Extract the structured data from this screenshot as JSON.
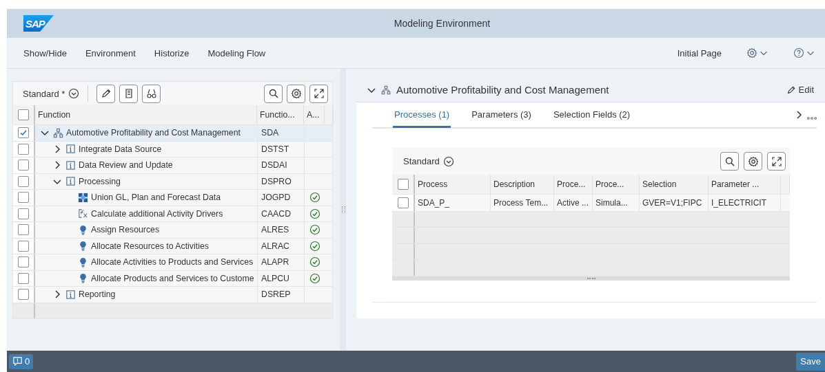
{
  "header": {
    "logo": "SAP",
    "title": "Modeling Environment"
  },
  "menu": {
    "items": [
      "Show/Hide",
      "Environment",
      "Historize",
      "Modeling Flow"
    ],
    "initial_page": "Initial Page"
  },
  "tree": {
    "variant": "Standard *",
    "all_checked": false,
    "columns": [
      "Function",
      "Functio...",
      "A..."
    ],
    "rows": [
      {
        "kind": "hierarchy",
        "name": "Automotive Profitability and Cost Management",
        "code": "SDA",
        "checked": true,
        "selected": true,
        "expanded": true,
        "done": false,
        "children": [
          {
            "kind": "info",
            "name": "Integrate Data Source",
            "code": "DSTST",
            "checked": false,
            "selected": false,
            "expanded": false,
            "done": false
          },
          {
            "kind": "info",
            "name": "Data Review and Update",
            "code": "DSDAI",
            "checked": false,
            "selected": false,
            "expanded": false,
            "done": false
          },
          {
            "kind": "info",
            "name": "Processing",
            "code": "DSPRO",
            "checked": false,
            "selected": false,
            "expanded": true,
            "done": false,
            "children": [
              {
                "kind": "union",
                "name": "Union GL, Plan and Forecast Data",
                "code": "JOGPD",
                "checked": false,
                "selected": false,
                "done": true
              },
              {
                "kind": "formula",
                "name": "Calculate additional Activity Drivers",
                "code": "CAACD",
                "checked": false,
                "selected": false,
                "done": true
              },
              {
                "kind": "allocation",
                "name": "Assign Resources",
                "code": "ALRES",
                "checked": false,
                "selected": false,
                "done": true
              },
              {
                "kind": "allocation",
                "name": "Allocate Resources to Activities",
                "code": "ALRAC",
                "checked": false,
                "selected": false,
                "done": true
              },
              {
                "kind": "allocation",
                "name": "Allocate Activities to Products and Services",
                "code": "ALAPR",
                "checked": false,
                "selected": false,
                "done": true
              },
              {
                "kind": "allocation",
                "name": "Allocate Products and Services to Custome",
                "code": "ALPCU",
                "checked": false,
                "selected": false,
                "done": true
              }
            ]
          },
          {
            "kind": "info",
            "name": "Reporting",
            "code": "DSREP",
            "checked": false,
            "selected": false,
            "expanded": false,
            "done": false
          }
        ]
      }
    ]
  },
  "detail": {
    "title": "Automotive Profitability and Cost Management",
    "edit": "Edit",
    "tabs": [
      {
        "label": "Processes (1)",
        "selected": true
      },
      {
        "label": "Parameters (3)",
        "selected": false
      },
      {
        "label": "Selection Fields (2)",
        "selected": false
      }
    ],
    "table": {
      "variant": "Standard",
      "all_checked": false,
      "columns": [
        "Process",
        "Description",
        "Proce...",
        "Proce...",
        "Selection",
        "Parameter ..."
      ],
      "rows": [
        {
          "checked": false,
          "cells": [
            "SDA_P_",
            "Process Tem...",
            "Active ...",
            "Simula...",
            "GVER=V1;FIPC",
            "I_ELECTRICIT"
          ]
        }
      ]
    }
  },
  "footer": {
    "messages": "0",
    "save": "Save"
  }
}
